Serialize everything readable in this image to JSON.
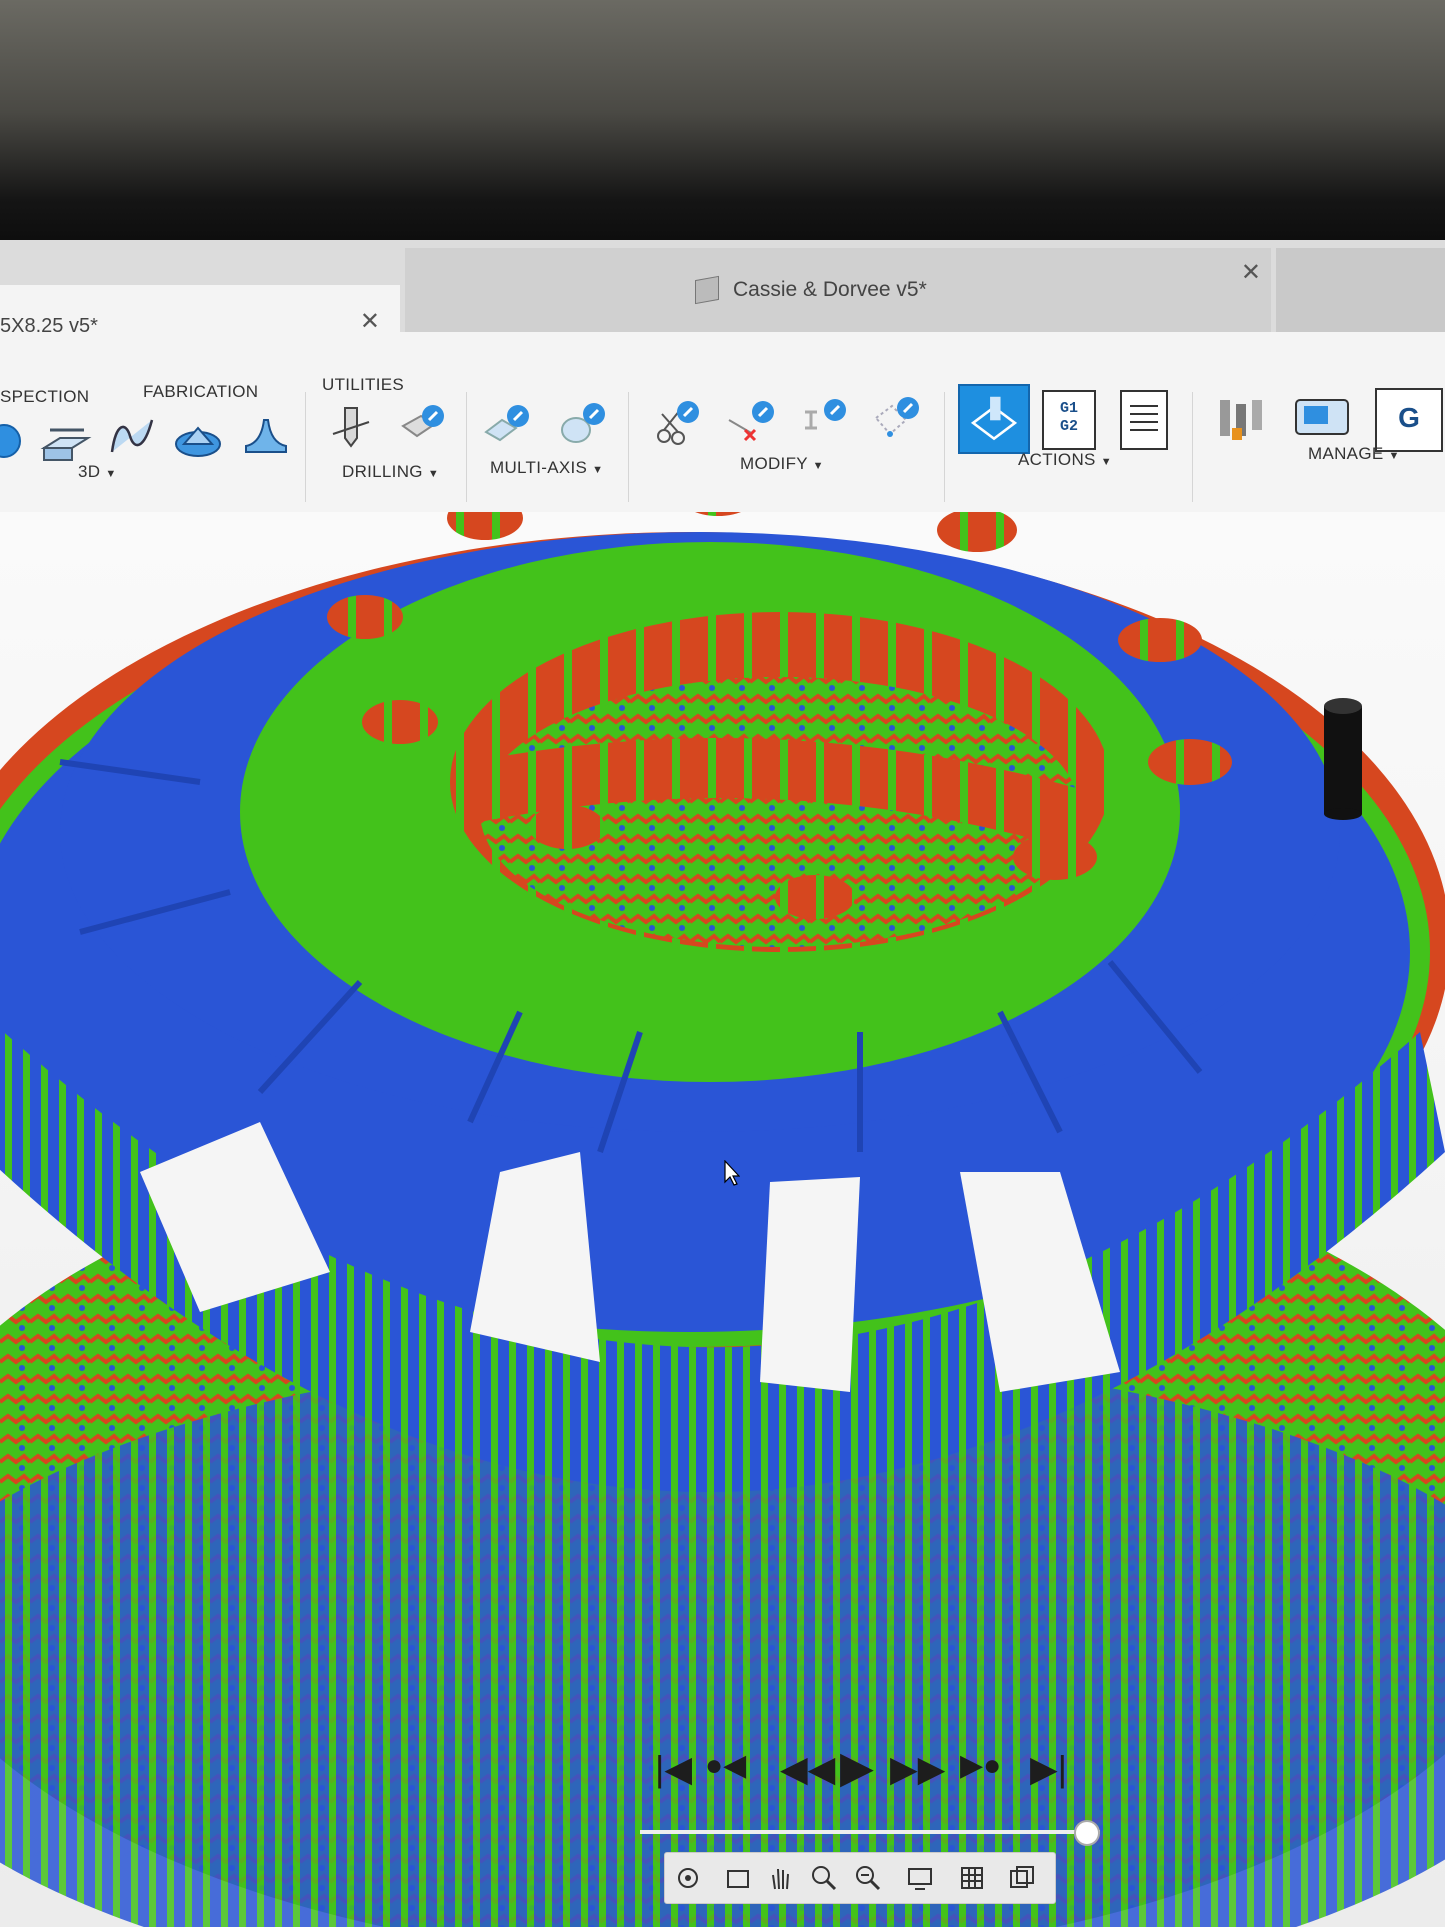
{
  "window": {
    "tabs": [
      {
        "label": "5X8.25 v5*",
        "close": "✕"
      },
      {
        "label": "Cassie & Dorvee v5*",
        "close": "✕"
      }
    ]
  },
  "toolbar": {
    "top_labels": [
      "SPECTION",
      "FABRICATION",
      "UTILITIES"
    ],
    "groups": [
      {
        "label": "3D",
        "dropdown": "▼"
      },
      {
        "label": "DRILLING",
        "dropdown": "▼"
      },
      {
        "label": "MULTI-AXIS",
        "dropdown": "▼"
      },
      {
        "label": "MODIFY",
        "dropdown": "▼"
      },
      {
        "label": "ACTIONS",
        "dropdown": "▼"
      },
      {
        "label": "MANAGE",
        "dropdown": "▼"
      }
    ],
    "actions_icon_text": [
      "G1",
      "G2"
    ],
    "manage_icon_text": "G"
  },
  "playback": {
    "buttons": [
      "|◀",
      "●◀",
      "◀◀",
      "▶",
      "▶▶",
      "▶●",
      "▶|"
    ],
    "progress": 1.0
  },
  "colors": {
    "stock_green": "#43c21b",
    "excess_blue": "#2a55d6",
    "gouge_red": "#d6471f",
    "selected_blue": "#1e8fe0"
  },
  "icons": [
    "orbit-icon",
    "look-at-icon",
    "pan-icon",
    "zoom-icon",
    "fit-icon",
    "display-settings-icon",
    "grid-icon",
    "viewports-icon"
  ]
}
